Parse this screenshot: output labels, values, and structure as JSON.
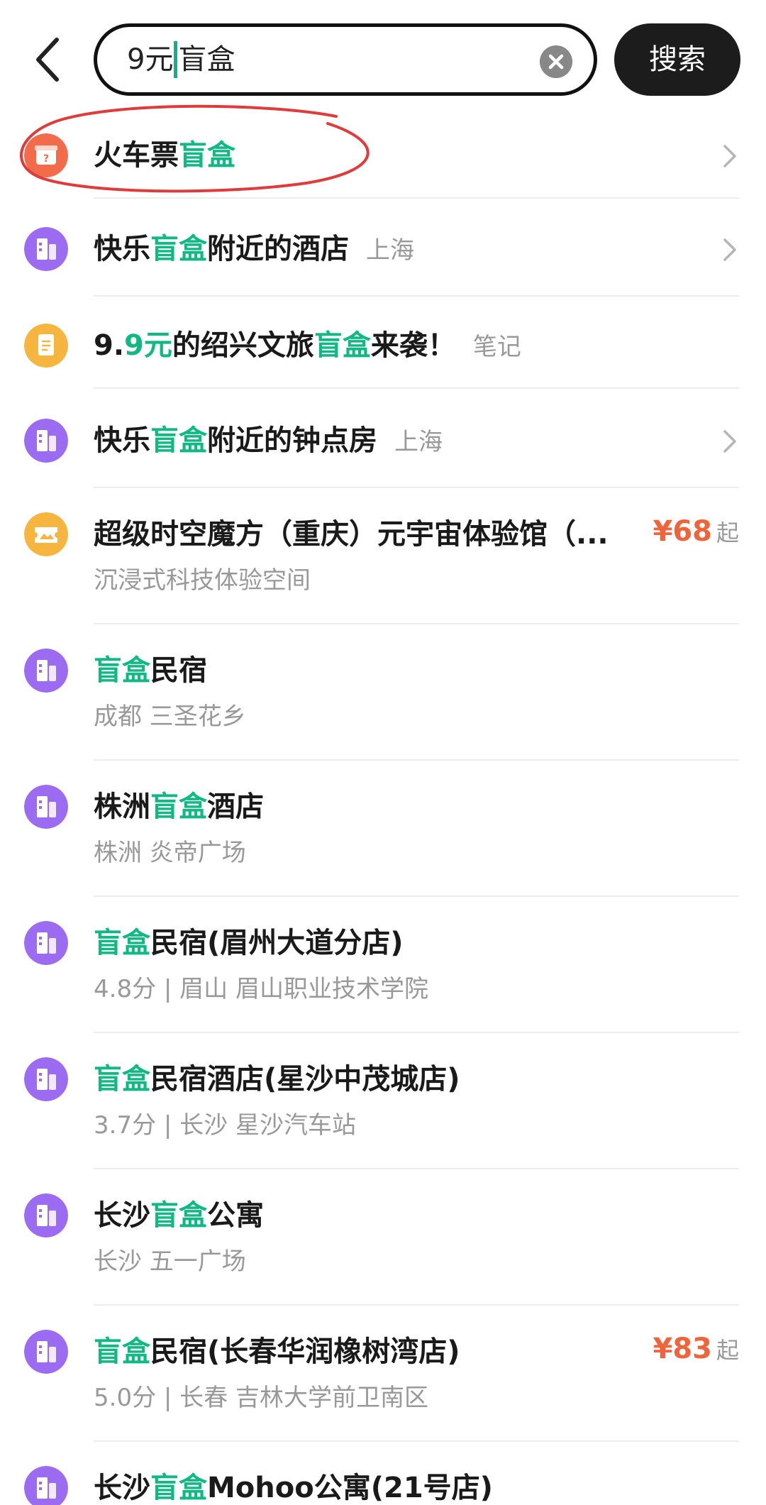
{
  "search": {
    "query_before": "9元",
    "query_after": "盲盒",
    "button_label": "搜索"
  },
  "icons": {
    "back": "chevron-left-icon",
    "clear": "clear-circle-icon",
    "chevron": "chevron-right-icon"
  },
  "colors": {
    "highlight": "#10b981",
    "price": "#f0643b",
    "hotel_icon": "#9b6bf2",
    "ticket_icon": "#f26b4b",
    "note_icon": "#f6b53f",
    "attraction_icon": "#f6b53f",
    "annotation": "#e03a3a"
  },
  "items": [
    {
      "icon": "mystery-box-icon",
      "t": [
        "火车票",
        "盲盒"
      ],
      "tag": "",
      "sub": "",
      "price": "",
      "chev": true
    },
    {
      "icon": "hotel-icon",
      "t": [
        "快乐",
        "盲盒",
        "附近的酒店"
      ],
      "tag": "上海",
      "sub": "",
      "price": "",
      "chev": true
    },
    {
      "icon": "note-icon",
      "t": [
        "9.",
        "9元",
        "的绍兴文旅",
        "盲盒",
        "来袭！"
      ],
      "tag": "笔记",
      "sub": "",
      "price": "",
      "chev": false
    },
    {
      "icon": "hotel-icon",
      "t": [
        "快乐",
        "盲盒",
        "附近的钟点房"
      ],
      "tag": "上海",
      "sub": "",
      "price": "",
      "chev": true
    },
    {
      "icon": "ticket-icon",
      "t": [
        "超级时空魔方（重庆）元宇宙体验馆（..."
      ],
      "tag": "",
      "sub": "沉浸式科技体验空间",
      "price": "¥68",
      "price_suffix": "起",
      "chev": false
    },
    {
      "icon": "hotel-icon",
      "t": [
        "",
        "盲盒",
        "民宿"
      ],
      "tag": "",
      "sub": "成都 三圣花乡",
      "price": "",
      "chev": false
    },
    {
      "icon": "hotel-icon",
      "t": [
        "株洲",
        "盲盒",
        "酒店"
      ],
      "tag": "",
      "sub": "株洲 炎帝广场",
      "price": "",
      "chev": false
    },
    {
      "icon": "hotel-icon",
      "t": [
        "",
        "盲盒",
        "民宿(眉州大道分店)"
      ],
      "tag": "",
      "sub": "4.8分 | 眉山 眉山职业技术学院",
      "price": "",
      "chev": false
    },
    {
      "icon": "hotel-icon",
      "t": [
        "",
        "盲盒",
        "民宿酒店(星沙中茂城店)"
      ],
      "tag": "",
      "sub": "3.7分 | 长沙 星沙汽车站",
      "price": "",
      "chev": false
    },
    {
      "icon": "hotel-icon",
      "t": [
        "长沙",
        "盲盒",
        "公寓"
      ],
      "tag": "",
      "sub": "长沙 五一广场",
      "price": "",
      "chev": false
    },
    {
      "icon": "hotel-icon",
      "t": [
        "",
        "盲盒",
        "民宿(长春华润橡树湾店)"
      ],
      "tag": "",
      "sub": "5.0分 | 长春 吉林大学前卫南区",
      "price": "¥83",
      "price_suffix": "起",
      "chev": false
    },
    {
      "icon": "hotel-icon",
      "t": [
        "长沙",
        "盲盒",
        "Mohoo公寓(21号店)"
      ],
      "tag": "",
      "sub": "",
      "price": "",
      "chev": false
    }
  ]
}
